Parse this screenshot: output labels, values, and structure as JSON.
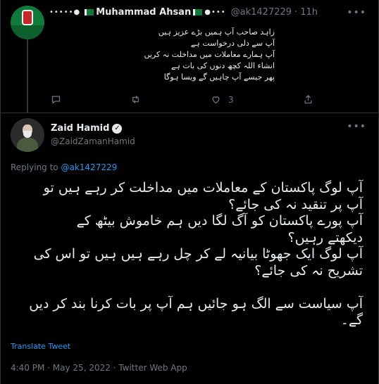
{
  "parent_tweet": {
    "display_name_decor_left": "•••••●",
    "display_name": "Muhammad Ahsan",
    "display_name_decor_right": "●•••",
    "handle": "@ak1427229",
    "time": "11h",
    "separator": "·",
    "more_icon": "more-horizontal-icon",
    "lines": [
      "زاہد صاحب آپ ہمیں بڑے عزیز ہیں",
      "آپ سے دلی درخواست ہے",
      "آپ ہمارے معاملات میں مداخلت نہ کریں",
      "انشاء اللہ کچھ دنوں کی بات ہے",
      "پھر جیسے آپ چاہیں گے ویسا ہوگا"
    ],
    "actions": {
      "reply_icon": "reply-icon",
      "retweet_icon": "retweet-icon",
      "like_icon": "heart-icon",
      "like_count": "3",
      "share_icon": "share-icon"
    }
  },
  "main_tweet": {
    "display_name": "Zaid Hamid",
    "verified_icon": "verified-badge-icon",
    "handle": "@ZaidZamanHamid",
    "more_icon": "more-horizontal-icon",
    "replying_to_label": "Replying to",
    "replying_to_handle": "@ak1427229",
    "lines": [
      "آپ لوگ پاکستان کے معاملات میں مداخلت کر رہے ہیں تو",
      "آپ پر تنقید نہ کی جائے؟",
      "آپ پورے پاکستان کو آگ لگا دیں ہم خاموش بیٹھ کے",
      "دیکھتے رہیں؟",
      "آپ لوگ ایک جھوٹا بیانیہ لے کر چل رہے ہیں ہیں تو اس کی",
      "تشریح نہ کی جائے؟",
      "",
      "آپ سیاست سے الگ ہو جائیں ہم آپ پر بات کرنا بند کر دیں",
      "گے۔"
    ],
    "translate_label": "Translate Tweet",
    "timestamp": "4:40 PM · May 25, 2022 · Twitter Web App"
  },
  "colors": {
    "background": "#000000",
    "text": "#e7e9ea",
    "secondary": "#71767b",
    "link": "#1d9bf0",
    "border": "#2f3336"
  }
}
